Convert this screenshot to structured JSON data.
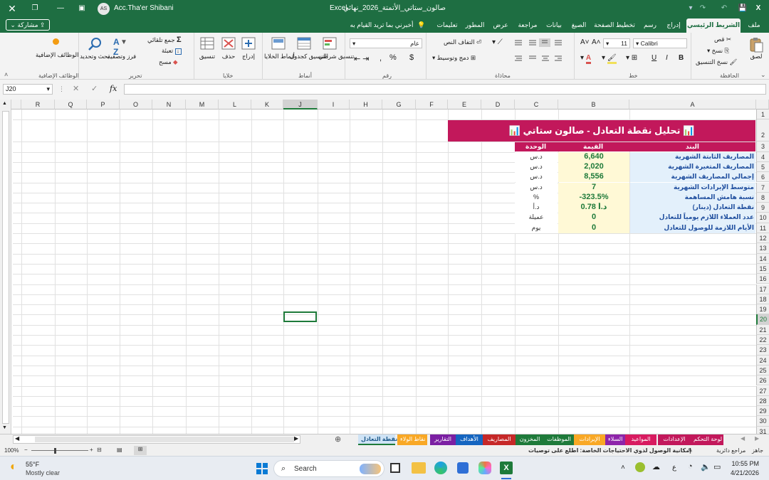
{
  "titlebar": {
    "app_name": "Excel",
    "file_name": "صالون_ستاتي_الأتمتة_2026_نهائي",
    "user_name": "Acc.Tha'er Shibani",
    "user_initials": "AS"
  },
  "menu": {
    "tabs": [
      "ملف",
      "الشريط الرئيسي",
      "إدراج",
      "رسم",
      "تخطيط الصفحة",
      "الصيغ",
      "بيانات",
      "مراجعة",
      "عرض",
      "المطور",
      "تعليمات"
    ],
    "active_tab": "الشريط الرئيسي",
    "tell_me": "أخبرني بما تريد القيام به",
    "share_label": "مشاركة"
  },
  "ribbon": {
    "clipboard": {
      "paste": "لصق",
      "cut": "قص",
      "copy": "نسخ",
      "format_painter": "نسخ التنسيق",
      "group": "الحافظة"
    },
    "font": {
      "name": "Calibri",
      "size": "11",
      "bold": "B",
      "italic": "I",
      "underline": "U",
      "group": "خط"
    },
    "alignment": {
      "wrap_text": "التفاف النص",
      "merge_center": "دمج وتوسيط",
      "group": "محاذاة"
    },
    "number": {
      "format": "عام",
      "group": "رقم"
    },
    "styles": {
      "conditional": "تنسيق شرطي",
      "as_table": "التنسيق كجدول",
      "cell_styles": "أنماط الخلايا",
      "group": "أنماط"
    },
    "cells": {
      "insert": "إدراج",
      "delete": "حذف",
      "format": "تنسيق",
      "group": "خلايا"
    },
    "editing": {
      "autosum": "جمع تلقائي",
      "fill": "تعبئة",
      "clear": "مسح",
      "sort_filter": "فرز وتصفية",
      "find_select": "بحث وتحديد",
      "group": "تحرير"
    },
    "addins": {
      "label": "الوظائف الإضافية",
      "group": "الوظائف الإضافية"
    }
  },
  "formula_bar": {
    "name_box": "J20",
    "fx": "fx",
    "formula": ""
  },
  "sheet": {
    "columns": [
      "A",
      "B",
      "C",
      "D",
      "E",
      "F",
      "G",
      "H",
      "I",
      "J",
      "K",
      "L",
      "M",
      "N",
      "O",
      "P",
      "Q",
      "R"
    ],
    "selected_column": "J",
    "rows": [
      "1",
      "2",
      "3",
      "4",
      "5",
      "6",
      "7",
      "8",
      "9",
      "10",
      "11",
      "12",
      "13",
      "14",
      "15",
      "16",
      "17",
      "18",
      "19",
      "20",
      "21",
      "22",
      "23",
      "24",
      "25",
      "26",
      "27",
      "28",
      "29",
      "30",
      "31"
    ],
    "selected_row": "20",
    "title": "📊 تحليل نقطة التعادل - صالون ستاتي 📊",
    "header": {
      "item": "البند",
      "value": "القيمة",
      "unit": "الوحدة"
    },
    "table": [
      {
        "item": "المصاريف الثابتة الشهرية",
        "value": "6,640",
        "unit": "د.س"
      },
      {
        "item": "المصاريف المتغيرة الشهرية",
        "value": "2,020",
        "unit": "د.س"
      },
      {
        "item": "إجمالي المصاريف الشهرية",
        "value": "8,556",
        "unit": "د.س"
      },
      {
        "item": "متوسط الإيرادات الشهرية",
        "value": "7",
        "unit": "د.س"
      },
      {
        "item": "نسبة هامش المساهمة",
        "value": "-323.5%",
        "unit": "%"
      },
      {
        "item": "نقطة التعادل (دينار)",
        "value": "0.78 د.أ",
        "unit": "د.أ"
      },
      {
        "item": "عدد العملاء اللازم يومياً للتعادل",
        "value": "0",
        "unit": "عميلة"
      },
      {
        "item": "الأيام اللازمة للوصول للتعادل",
        "value": "0",
        "unit": "يوم"
      }
    ],
    "colors": {
      "title_bg": "#c2185b",
      "header_bg": "#c2185b",
      "label_bg": "#e3f0fb",
      "value_bg": "#fff9d6",
      "value_text": "#1e7a3a",
      "label_text": "#1f4e9e"
    }
  },
  "sheet_tabs": [
    {
      "name": "لوحة التحكم",
      "color": "#c2185b"
    },
    {
      "name": "الإعدادات",
      "color": "#c2185b"
    },
    {
      "name": "المواعيد",
      "color": "#d81b60"
    },
    {
      "name": "السلاء",
      "color": "#8e24aa"
    },
    {
      "name": "الإيرادات",
      "color": "#f9a825"
    },
    {
      "name": "الموظفات",
      "color": "#1e7a3a"
    },
    {
      "name": "المخزون",
      "color": "#1e7a3a"
    },
    {
      "name": "المصاريف",
      "color": "#c62828"
    },
    {
      "name": "الأهداف",
      "color": "#1565c0"
    },
    {
      "name": "التقارير",
      "color": "#7b1fa2"
    },
    {
      "name": "نقاط الولاء",
      "color": "#f9a825"
    },
    {
      "name": "نقطة التعادل",
      "color": "#cfe3f5",
      "active": true
    }
  ],
  "status_bar": {
    "ready": "جاهز",
    "accessibility": "مراجع دائرية",
    "zoom": "100%",
    "notice": "إمكانية الوصول لذوي الاحتياجات الخاصة: اطلع على توصيات"
  },
  "taskbar": {
    "weather_temp": "55°F",
    "weather_text": "Mostly clear",
    "search": "Search",
    "time": "10:55 PM",
    "date": "4/21/2026",
    "lang": "ع"
  }
}
